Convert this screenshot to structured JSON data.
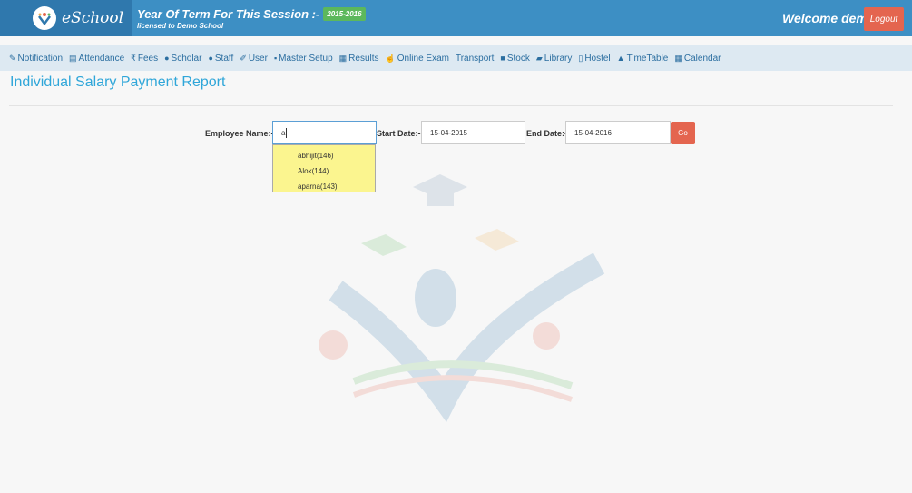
{
  "header": {
    "app_name": "eSchool",
    "session_label": "Year Of Term For This Session :-",
    "session_value": "2015-2016",
    "licensed": "licensed to Demo School",
    "welcome": "Welcome demo l",
    "logout": "Logout"
  },
  "nav": [
    {
      "label": "Notification",
      "icon": "bullhorn-icon",
      "glyph": "✎"
    },
    {
      "label": "Attendance",
      "icon": "document-icon",
      "glyph": "▤"
    },
    {
      "label": "Fees",
      "icon": "rupee-icon",
      "glyph": "₹"
    },
    {
      "label": "Scholar",
      "icon": "users-icon",
      "glyph": "●"
    },
    {
      "label": "Staff",
      "icon": "user-icon",
      "glyph": "●"
    },
    {
      "label": "User",
      "icon": "wrench-icon",
      "glyph": "✐"
    },
    {
      "label": "Master Setup",
      "icon": "unlock-icon",
      "glyph": "▪"
    },
    {
      "label": "Results",
      "icon": "chart-icon",
      "glyph": "▦"
    },
    {
      "label": "Online Exam",
      "icon": "thumbs-up-icon",
      "glyph": "☝"
    },
    {
      "label": "Transport",
      "icon": "",
      "glyph": ""
    },
    {
      "label": "Stock",
      "icon": "folder-icon",
      "glyph": "■"
    },
    {
      "label": "Library",
      "icon": "book-icon",
      "glyph": "▰"
    },
    {
      "label": "Hostel",
      "icon": "building-icon",
      "glyph": "▯"
    },
    {
      "label": "TimeTable",
      "icon": "bell-icon",
      "glyph": "▲"
    },
    {
      "label": "Calendar",
      "icon": "calendar-icon",
      "glyph": "▦"
    }
  ],
  "page": {
    "title": "Individual Salary Payment Report"
  },
  "form": {
    "employee_label": "Employee Name:-",
    "employee_value": "a",
    "start_label": "Start Date:-",
    "start_value": "15-04-2015",
    "end_label": "End Date:-",
    "end_value": "15-04-2016",
    "go": "Go"
  },
  "suggestions": [
    "abhijit(146)",
    "Alok(144)",
    "aparna(143)"
  ],
  "colors": {
    "header": "#3d8fc4",
    "logo_bg": "#2f78ad",
    "nav_bg": "#dde9f2",
    "title": "#2fa6d9",
    "danger": "#e4654f",
    "badge": "#5cb85c",
    "suggest_bg": "#fbf58f"
  }
}
